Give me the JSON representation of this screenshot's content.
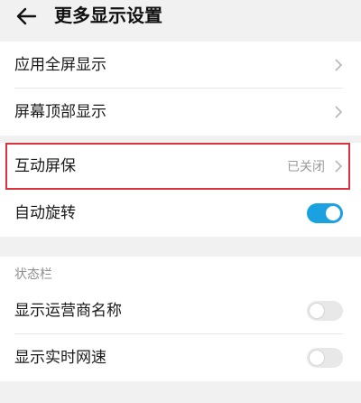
{
  "header": {
    "back_icon": "arrow-left-icon",
    "title": "更多显示设置"
  },
  "group1": [
    {
      "label": "应用全屏显示",
      "icon": "chevron-right-icon"
    },
    {
      "label": "屏幕顶部显示",
      "icon": "chevron-right-icon"
    }
  ],
  "group2": {
    "interactive_screensaver": {
      "label": "互动屏保",
      "value": "已关闭",
      "icon": "chevron-right-icon"
    },
    "auto_rotate": {
      "label": "自动旋转",
      "state": "on"
    }
  },
  "status_bar": {
    "section_title": "状态栏",
    "items": [
      {
        "label": "显示运营商名称",
        "state": "off"
      },
      {
        "label": "显示实时网速",
        "state": "off"
      }
    ]
  },
  "colors": {
    "accent": "#1aa1e0",
    "highlight_border": "#d9343f",
    "background": "#f1f1f1"
  }
}
